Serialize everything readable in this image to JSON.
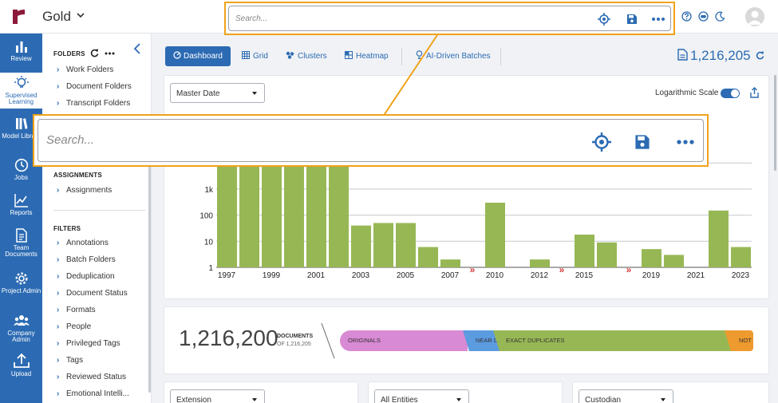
{
  "workspace": {
    "name": "Gold"
  },
  "search": {
    "placeholder": "Search..."
  },
  "sidebar": {
    "items": [
      {
        "label": "Review",
        "icon": "bar-chart-icon",
        "active": false
      },
      {
        "label": "Supervised Learning",
        "icon": "lightbulb-icon",
        "active": true
      },
      {
        "label": "Model Library",
        "icon": "library-icon",
        "active": false
      },
      {
        "label": "Jobs",
        "icon": "clock-icon",
        "active": false
      },
      {
        "label": "Reports",
        "icon": "line-chart-icon",
        "active": false
      },
      {
        "label": "Team Documents",
        "icon": "document-icon",
        "active": false
      },
      {
        "label": "Project Admin",
        "icon": "gear-icon",
        "active": false
      },
      {
        "label": "Company Admin",
        "icon": "users-icon",
        "active": false
      },
      {
        "label": "Upload",
        "icon": "upload-icon",
        "active": false
      }
    ]
  },
  "folders_panel": {
    "folders_heading": "FOLDERS",
    "folders": [
      "Work Folders",
      "Document Folders",
      "Transcript Folders"
    ],
    "assignments_heading": "ASSIGNMENTS",
    "assignments": [
      "Assignments"
    ],
    "filters_heading": "FILTERS",
    "filters": [
      "Annotations",
      "Batch Folders",
      "Deduplication",
      "Document Status",
      "Formats",
      "People",
      "Privileged Tags",
      "Tags",
      "Reviewed Status",
      "Emotional Intelli..."
    ]
  },
  "tabs": [
    "Dashboard",
    "Grid",
    "Clusters",
    "Heatmap",
    "AI-Driven Batches"
  ],
  "document_total": "1,216,205",
  "date_filter": {
    "selected": "Master Date"
  },
  "log_scale": {
    "label": "Logarithmic Scale",
    "on": true
  },
  "chart_data": {
    "type": "bar",
    "log_scale": true,
    "y_ticks": [
      "1",
      "10",
      "100",
      "1k"
    ],
    "x_tick_labels": [
      "1997",
      "1999",
      "2001",
      "2003",
      "2005",
      "2007",
      "2010",
      "2012",
      "2015",
      "2019",
      "2021",
      "2023"
    ],
    "categories": [
      "1997",
      "1998",
      "1999",
      "2000",
      "2001",
      "2002",
      "2003",
      "2004",
      "2005",
      "2006",
      "2007",
      "2010",
      "2012",
      "2015",
      "2016",
      "2019",
      "2020",
      "2021",
      "2022",
      "2023"
    ],
    "values": [
      10000,
      10000,
      10000,
      10000,
      10000,
      10000,
      40,
      50,
      50,
      6,
      2,
      300,
      2,
      18,
      9,
      5,
      3,
      1,
      150,
      6
    ],
    "gap_markers_after": [
      "2007",
      "2012",
      "2016"
    ],
    "bar_color": "#97b755"
  },
  "dedup_summary": {
    "count": "1,216,200",
    "label": "DOCUMENTS",
    "sub_label": "OF 1,216,205",
    "segments": [
      {
        "label": "ORIGINALS",
        "color": "#d98ad4"
      },
      {
        "label": "NEAR D",
        "color": "#5b9be0"
      },
      {
        "label": "EXACT DUPLICATES",
        "color": "#97b755"
      },
      {
        "label": "NOT",
        "color": "#ee9a2e"
      }
    ]
  },
  "bottom_filters": [
    "Extension",
    "All Entities",
    "Custodian"
  ]
}
